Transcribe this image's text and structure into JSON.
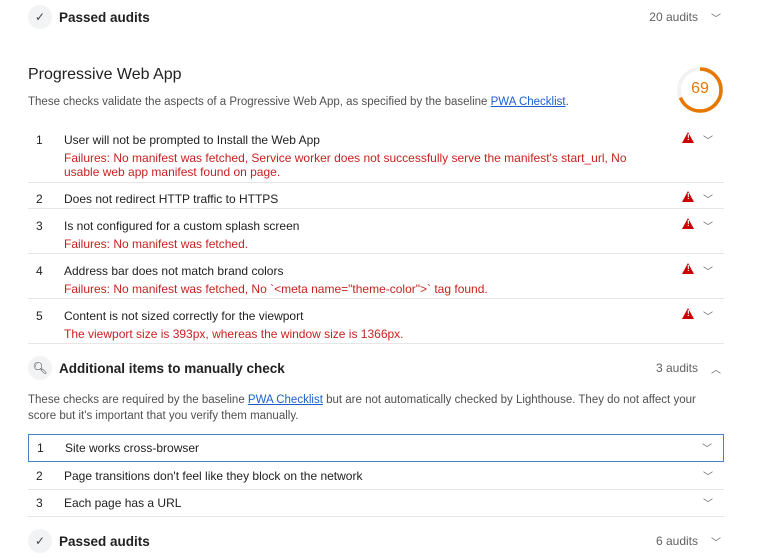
{
  "top_passed": {
    "title": "Passed audits",
    "count": "20 audits"
  },
  "pwa": {
    "title": "Progressive Web App",
    "description_prefix": "These checks validate the aspects of a Progressive Web App, as specified by the baseline ",
    "link": "PWA Checklist",
    "description_suffix": ".",
    "score": "69",
    "score_value": 69,
    "score_color": "#e67700",
    "audits": [
      {
        "num": "1",
        "title": "User will not be prompted to Install the Web App",
        "failure": "Failures: No manifest was fetched, Service worker does not successfully serve the manifest's start_url, No usable web app manifest found on page."
      },
      {
        "num": "2",
        "title": "Does not redirect HTTP traffic to HTTPS"
      },
      {
        "num": "3",
        "title": "Is not configured for a custom splash screen",
        "failure": "Failures: No manifest was fetched."
      },
      {
        "num": "4",
        "title": "Address bar does not match brand colors",
        "failure": "Failures: No manifest was fetched, No `<meta name=\"theme-color\">` tag found."
      },
      {
        "num": "5",
        "title": "Content is not sized correctly for the viewport",
        "failure": "The viewport size is 393px, whereas the window size is 1366px."
      }
    ]
  },
  "manual": {
    "title": "Additional items to manually check",
    "count": "3 audits",
    "desc_prefix": "These checks are required by the baseline ",
    "link": "PWA Checklist",
    "desc_suffix": " but are not automatically checked by Lighthouse. They do not affect your score but it's important that you verify them manually.",
    "items": [
      {
        "num": "1",
        "title": "Site works cross-browser"
      },
      {
        "num": "2",
        "title": "Page transitions don't feel like they block on the network"
      },
      {
        "num": "3",
        "title": "Each page has a URL"
      }
    ]
  },
  "bottom_passed": {
    "title": "Passed audits",
    "count": "6 audits"
  },
  "colors": {
    "fail": "#c7221f",
    "link": "#1a5fcd",
    "gauge": "#e67700"
  }
}
